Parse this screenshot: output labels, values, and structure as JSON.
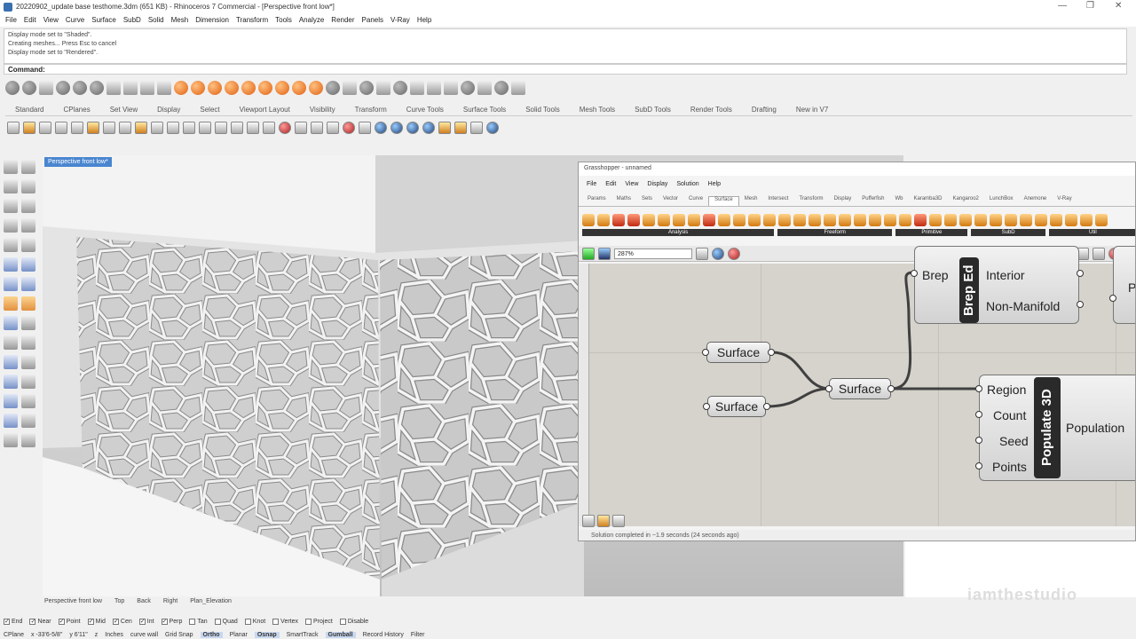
{
  "window": {
    "title": "20220902_update base testhome.3dm (651 KB) - Rhinoceros 7 Commercial - [Perspective front low*]"
  },
  "menubar": [
    "File",
    "Edit",
    "View",
    "Curve",
    "Surface",
    "SubD",
    "Solid",
    "Mesh",
    "Dimension",
    "Transform",
    "Tools",
    "Analyze",
    "Render",
    "Panels",
    "V-Ray",
    "Help"
  ],
  "command_history": [
    "Display mode set to \"Shaded\".",
    "Creating meshes... Press Esc to cancel",
    "Display mode set to \"Rendered\"."
  ],
  "command_prompt": "Command:",
  "toolbar_tabs": [
    "Standard",
    "CPlanes",
    "Set View",
    "Display",
    "Select",
    "Viewport Layout",
    "Visibility",
    "Transform",
    "Curve Tools",
    "Surface Tools",
    "Solid Tools",
    "Mesh Tools",
    "SubD Tools",
    "Render Tools",
    "Drafting",
    "New in V7"
  ],
  "viewport": {
    "label": "Perspective front low*"
  },
  "viewport_tabs": [
    "Perspective front low",
    "Top",
    "Back",
    "Right",
    "Plan_Elevation"
  ],
  "osnaps": [
    {
      "label": "End",
      "checked": true
    },
    {
      "label": "Near",
      "checked": true
    },
    {
      "label": "Point",
      "checked": true
    },
    {
      "label": "Mid",
      "checked": true
    },
    {
      "label": "Cen",
      "checked": true
    },
    {
      "label": "Int",
      "checked": true
    },
    {
      "label": "Perp",
      "checked": true
    },
    {
      "label": "Tan",
      "checked": false
    },
    {
      "label": "Quad",
      "checked": false
    },
    {
      "label": "Knot",
      "checked": false
    },
    {
      "label": "Vertex",
      "checked": false
    },
    {
      "label": "Project",
      "checked": false
    },
    {
      "label": "Disable",
      "checked": false
    }
  ],
  "statusbar": {
    "cplane": "CPlane",
    "x": "x -33'6-5/8\"",
    "y": "y 6'11\"",
    "z": "z",
    "units": "Inches",
    "layer": "curve wall",
    "grid_snap": "Grid Snap",
    "ortho": "Ortho",
    "planar": "Planar",
    "osnap": "Osnap",
    "smarttrack": "SmartTrack",
    "gumball": "Gumball",
    "record_history": "Record History",
    "filter": "Filter"
  },
  "grasshopper": {
    "title": "Grasshopper - unnamed",
    "menu": [
      "File",
      "Edit",
      "View",
      "Display",
      "Solution",
      "Help"
    ],
    "tabs": [
      "Params",
      "Maths",
      "Sets",
      "Vector",
      "Curve",
      "Surface",
      "Mesh",
      "Intersect",
      "Transform",
      "Display",
      "Pufferfish",
      "Wb",
      "Karamba3D",
      "Kangaroo2",
      "LunchBox",
      "Anemone",
      "V-Ray"
    ],
    "selected_tab": "Surface",
    "panels": [
      "Analysis",
      "Freeform",
      "Primitive",
      "SubD",
      "Util"
    ],
    "zoom": "287%",
    "status": "Solution completed in ~1.9 seconds (24 seconds ago)",
    "nodes": {
      "surface_a": "Surface",
      "surface_b": "Surface",
      "surface_c": "Surface"
    },
    "brep_edges": {
      "name": "Brep Ed",
      "input": "Brep",
      "outputs": [
        "Interior",
        "Non-Manifold"
      ]
    },
    "populate3d": {
      "name": "Populate 3D",
      "inputs": [
        "Region",
        "Count",
        "Seed",
        "Points"
      ],
      "output": "Population"
    },
    "partial_right": "Pr"
  },
  "watermark": "iamthestudio",
  "colors": {
    "accent": "#4a86d0",
    "canvas": "#d5d3cb",
    "wire": "#404040"
  }
}
